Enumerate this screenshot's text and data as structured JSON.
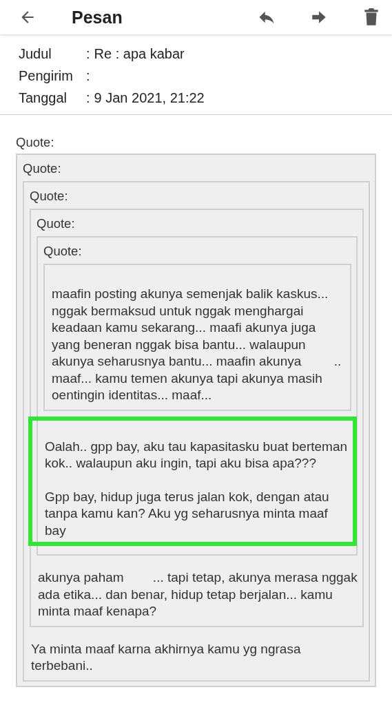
{
  "header": {
    "title": "Pesan"
  },
  "meta": [
    {
      "label": "Judul",
      "separator": ":",
      "value": "Re : apa kabar"
    },
    {
      "label": "Pengirim",
      "separator": ":"
    },
    {
      "label": "Tanggal",
      "separator": ":",
      "value": "9 Jan 2021, 21:22"
    }
  ],
  "message": {
    "label": "Quote:",
    "quote": {
      "label": "Quote:",
      "quote": {
        "label": "Quote:",
        "quote": {
          "label": "Quote:",
          "quote": {
            "label": "Quote:",
            "paragraphs": [
              "maafin posting akunya semenjak balik kaskus... nggak bermaksud untuk nggak menghargai keadaan kamu sekarang... maafi akunya juga yang beneran nggak bisa bantu... walaupun akunya seharusnya bantu... maafin akunya         .. maaf... kamu temen akunya tapi akunya masih oentingin identitas... maaf..."
            ]
          },
          "paragraphs": [
            "Oalah.. gpp bay, aku tau kapasitasku buat berteman kok.. walaupun aku ingin, tapi aku bisa apa???",
            "Gpp bay, hidup juga terus jalan kok, dengan atau tanpa kamu kan? Aku yg seharusnya minta maaf bay"
          ],
          "highlighted": true
        },
        "paragraphs": [
          "akunya paham        ... tapi tetap, akunya merasa nggak ada etika... dan benar, hidup tetap berjalan... kamu minta maaf kenapa?"
        ]
      },
      "paragraphs": [
        "Ya minta maaf karna akhirnya kamu yg ngrasa terbebani.."
      ]
    }
  }
}
